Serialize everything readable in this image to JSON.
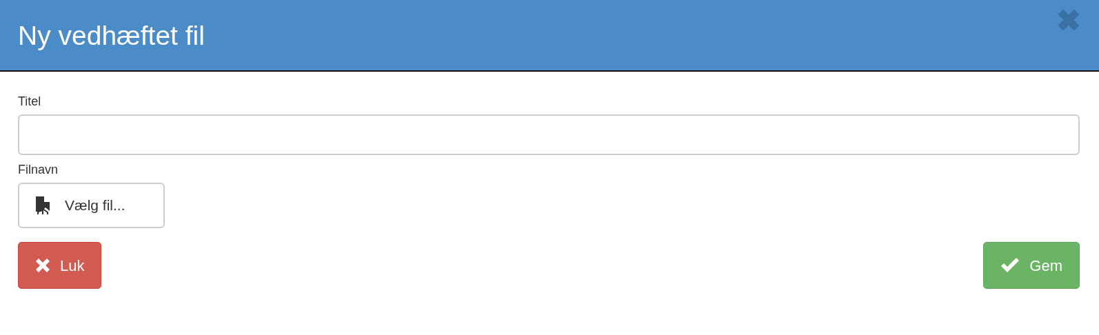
{
  "dialog": {
    "title": "Ny vedhæftet fil"
  },
  "fields": [
    {
      "kind": "text",
      "label": "Titel"
    },
    {
      "kind": "file",
      "label": "Filnavn",
      "button": "Vælg fil..."
    }
  ],
  "buttons": [
    {
      "kind": "danger",
      "label": "Luk"
    },
    {
      "kind": "success",
      "label": "Gem"
    }
  ]
}
